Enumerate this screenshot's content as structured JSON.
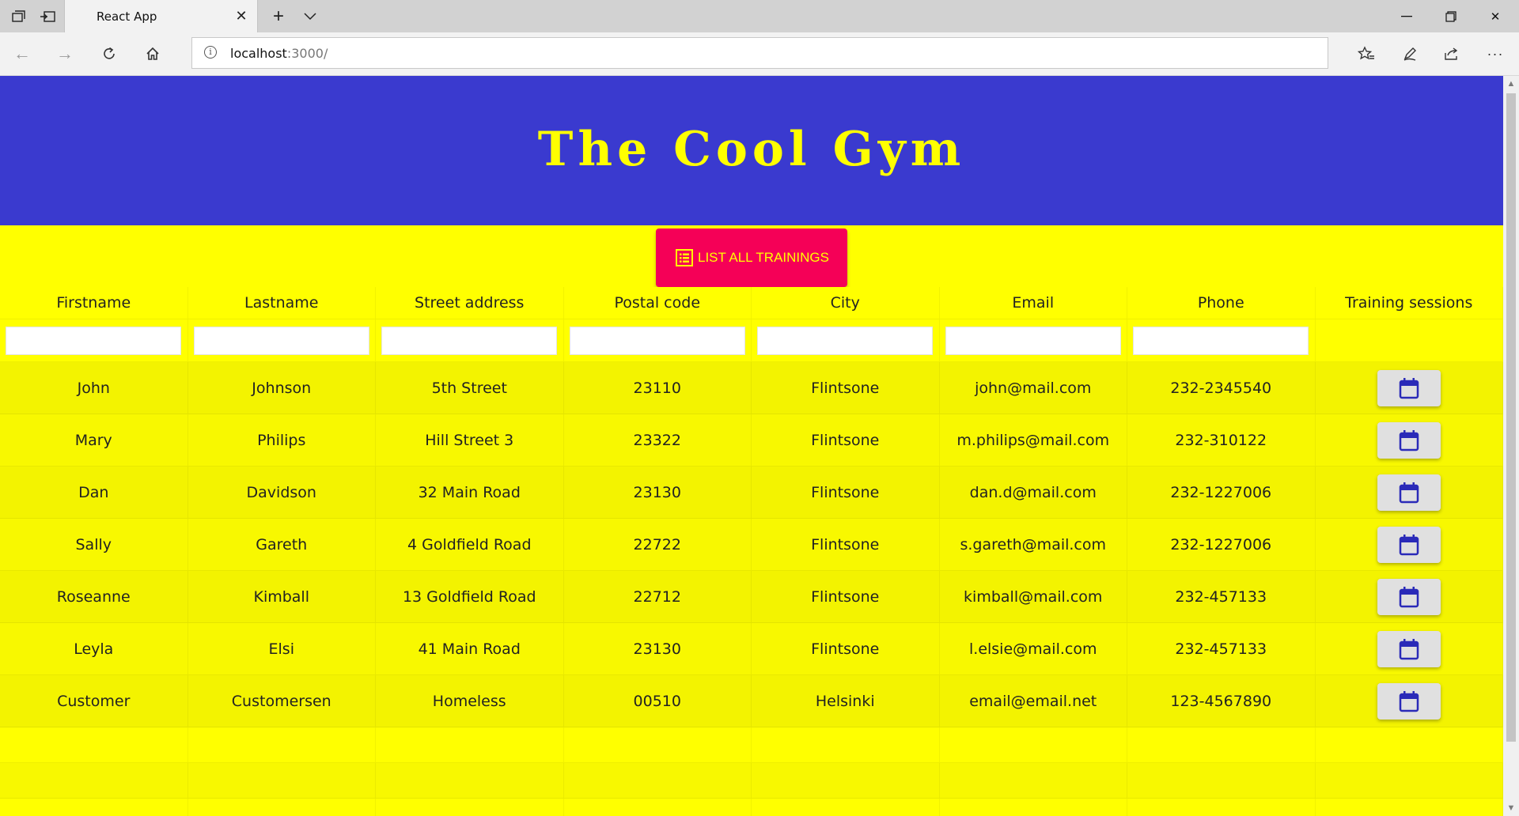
{
  "browser": {
    "tab_title": "React App",
    "url_host": "localhost",
    "url_rest": ":3000/"
  },
  "page": {
    "title": "The Cool Gym",
    "list_button_label": "LIST ALL TRAININGS"
  },
  "colors": {
    "header_bg": "#3a3acf",
    "page_bg": "#ffff00",
    "accent": "#f50057",
    "calendar_icon": "#2a2ab8"
  },
  "table": {
    "columns": [
      "Firstname",
      "Lastname",
      "Street address",
      "Postal code",
      "City",
      "Email",
      "Phone",
      "Training sessions"
    ],
    "rows": [
      [
        "John",
        "Johnson",
        "5th Street",
        "23110",
        "Flintsone",
        "john@mail.com",
        "232-2345540"
      ],
      [
        "Mary",
        "Philips",
        "Hill Street 3",
        "23322",
        "Flintsone",
        "m.philips@mail.com",
        "232-310122"
      ],
      [
        "Dan",
        "Davidson",
        "32 Main Road",
        "23130",
        "Flintsone",
        "dan.d@mail.com",
        "232-1227006"
      ],
      [
        "Sally",
        "Gareth",
        "4 Goldfield Road",
        "22722",
        "Flintsone",
        "s.gareth@mail.com",
        "232-1227006"
      ],
      [
        "Roseanne",
        "Kimball",
        "13 Goldfield Road",
        "22712",
        "Flintsone",
        "kimball@mail.com",
        "232-457133"
      ],
      [
        "Leyla",
        "Elsi",
        "41 Main Road",
        "23130",
        "Flintsone",
        "l.elsie@mail.com",
        "232-457133"
      ],
      [
        "Customer",
        "Customersen",
        "Homeless",
        "00510",
        "Helsinki",
        "email@email.net",
        "123-4567890"
      ]
    ]
  }
}
